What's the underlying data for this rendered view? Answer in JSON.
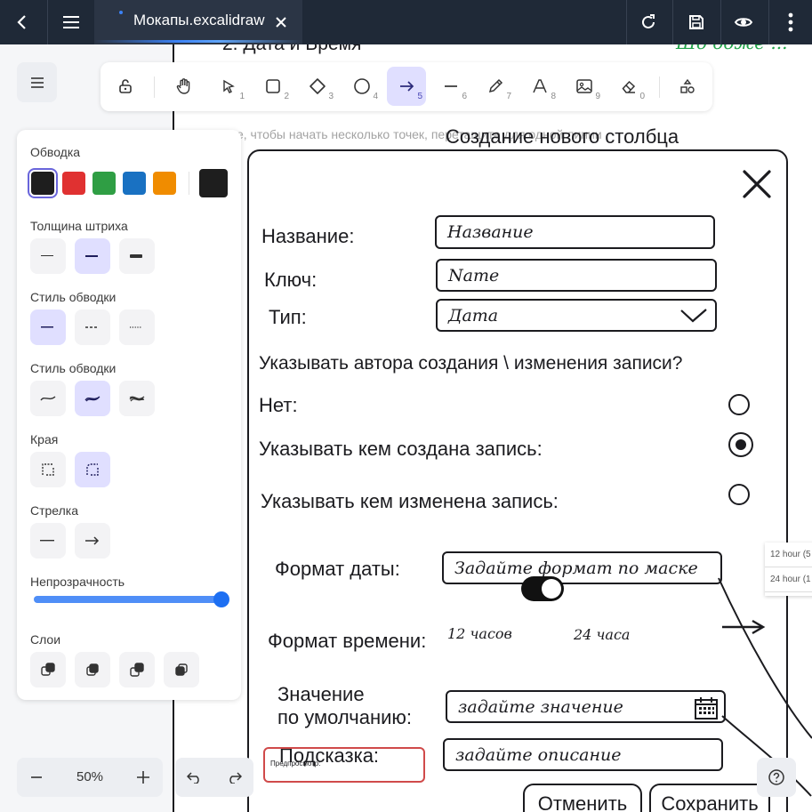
{
  "appbar": {
    "tab_title": "Мокапы.excalidraw"
  },
  "canvas": {
    "heading_partial": "2. Дата и Время",
    "green_text": "Шо боже ...",
    "hint": "Нажмите, чтобы начать несколько точек, перетащите для одной линии"
  },
  "toolbar": {
    "tools": [
      {
        "name": "lock",
        "num": ""
      },
      {
        "name": "hand",
        "num": ""
      },
      {
        "name": "selection",
        "num": "1"
      },
      {
        "name": "rectangle",
        "num": "2"
      },
      {
        "name": "diamond",
        "num": "3"
      },
      {
        "name": "ellipse",
        "num": "4"
      },
      {
        "name": "arrow",
        "num": "5"
      },
      {
        "name": "line",
        "num": "6"
      },
      {
        "name": "draw",
        "num": "7"
      },
      {
        "name": "text",
        "num": "8"
      },
      {
        "name": "image",
        "num": "9"
      },
      {
        "name": "eraser",
        "num": "0"
      },
      {
        "name": "shapes",
        "num": ""
      }
    ]
  },
  "panel": {
    "stroke_label": "Обводка",
    "stroke_colors": [
      "#1e1e1e",
      "#e03131",
      "#2f9e44",
      "#1971c2",
      "#f08c00"
    ],
    "stroke_current": "#1e1e1e",
    "width_label": "Толщина штриха",
    "style_label": "Стиль обводки",
    "sloppiness_label": "Стиль обводки",
    "edges_label": "Края",
    "arrow_label": "Стрелка",
    "opacity_label": "Непрозрачность",
    "opacity_value": 100,
    "layers_label": "Слои"
  },
  "mockup": {
    "title": "Создание нового столбца",
    "name_label": "Название:",
    "name_value": "Название",
    "key_label": "Ключ:",
    "key_value": "Name",
    "type_label": "Тип:",
    "type_value": "Дата",
    "question": "Указывать автора создания \\ изменения записи?",
    "opt_no": "Нет:",
    "opt_created": "Указывать кем создана запись:",
    "opt_modified": "Указывать кем изменена запись:",
    "date_format_label": "Формат даты:",
    "date_format_value": "Задайте формат по маске",
    "time_format_label": "Формат времени:",
    "time_12": "12 часов",
    "time_24": "24 часа",
    "default_label_1": "Значение",
    "default_label_2": "по умолчанию:",
    "default_value": "задайте значение",
    "hint_label": "Подсказка:",
    "hint_value": "задайте описание",
    "cancel": "Отменить",
    "save": "Сохранить",
    "preview": "Предпросмотр:",
    "dropdown": [
      "12 hour (5",
      "24 hour (1"
    ]
  },
  "zoom": {
    "value": "50%"
  }
}
